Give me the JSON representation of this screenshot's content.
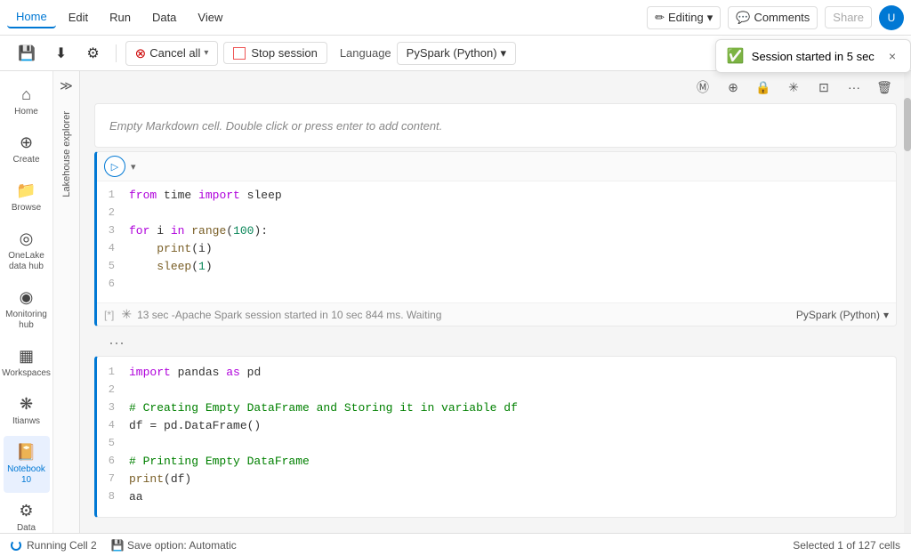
{
  "menu": {
    "tabs": [
      "Home",
      "Edit",
      "Run",
      "Data",
      "View"
    ],
    "active_tab": "Home",
    "editing_label": "Editing",
    "comments_label": "Comments",
    "share_label": "Share",
    "user_initials": "U"
  },
  "toolbar": {
    "cancel_label": "Cancel all",
    "stop_label": "Stop session",
    "language_label": "Language",
    "lang_value": "PySpark (Python)"
  },
  "toast": {
    "message": "Session started in 5 sec",
    "close_label": "×"
  },
  "sidebar": {
    "items": [
      {
        "id": "home",
        "icon": "⌂",
        "label": "Home"
      },
      {
        "id": "create",
        "icon": "+",
        "label": "Create"
      },
      {
        "id": "browse",
        "icon": "📁",
        "label": "Browse"
      },
      {
        "id": "onelake",
        "icon": "◎",
        "label": "OneLake data hub"
      },
      {
        "id": "monitoring",
        "icon": "◉",
        "label": "Monitoring hub"
      },
      {
        "id": "workspaces",
        "icon": "▦",
        "label": "Workspaces"
      },
      {
        "id": "itianws",
        "icon": "❋",
        "label": "Itianws"
      },
      {
        "id": "notebook",
        "icon": "📔",
        "label": "Notebook 10",
        "active": true
      },
      {
        "id": "data_eng",
        "icon": "⚙",
        "label": "Data Engineering"
      }
    ]
  },
  "explorer": {
    "label": "Lakehouse explorer"
  },
  "cells": {
    "markdown_hint": "Empty Markdown cell. Double click or press enter to add content.",
    "cell1": {
      "lines": [
        {
          "num": "1",
          "code": "<span class='kw'>from</span> time <span class='kw'>import</span> sleep"
        },
        {
          "num": "2",
          "code": ""
        },
        {
          "num": "3",
          "code": "<span class='kw'>for</span> i <span class='kw'>in</span> <span class='fn'>range</span>(<span class='num'>100</span>):"
        },
        {
          "num": "4",
          "code": "    <span class='fn'>print</span>(i)"
        },
        {
          "num": "5",
          "code": "    <span class='fn'>sleep</span>(<span class='num'>1</span>)"
        },
        {
          "num": "6",
          "code": ""
        }
      ],
      "cell_id": "[*]",
      "status": "13 sec -Apache Spark session started in 10 sec 844 ms. Waiting",
      "lang": "PySpark (Python)"
    },
    "cell2": {
      "lines": [
        {
          "num": "1",
          "code": "<span class='import-kw'>import</span> pandas <span class='as-kw'>as</span> pd"
        },
        {
          "num": "2",
          "code": ""
        },
        {
          "num": "3",
          "code": "<span class='comment'># Creating Empty DataFrame and Storing it in variable df</span>"
        },
        {
          "num": "4",
          "code": "df = pd.DataFrame()"
        },
        {
          "num": "5",
          "code": ""
        },
        {
          "num": "6",
          "code": "<span class='comment'># Printing Empty DataFrame</span>"
        },
        {
          "num": "7",
          "code": "<span class='fn'>print</span>(df)"
        },
        {
          "num": "8",
          "code": "aa"
        }
      ]
    }
  },
  "status_bar": {
    "running_label": "Running Cell 2",
    "save_label": "Save option: Automatic",
    "selection_label": "Selected 1 of 127 cells"
  },
  "cell_toolbar_icons": [
    "Ⓜ",
    "⊕",
    "🔒",
    "✳",
    "⊡",
    "···",
    "🗑"
  ]
}
